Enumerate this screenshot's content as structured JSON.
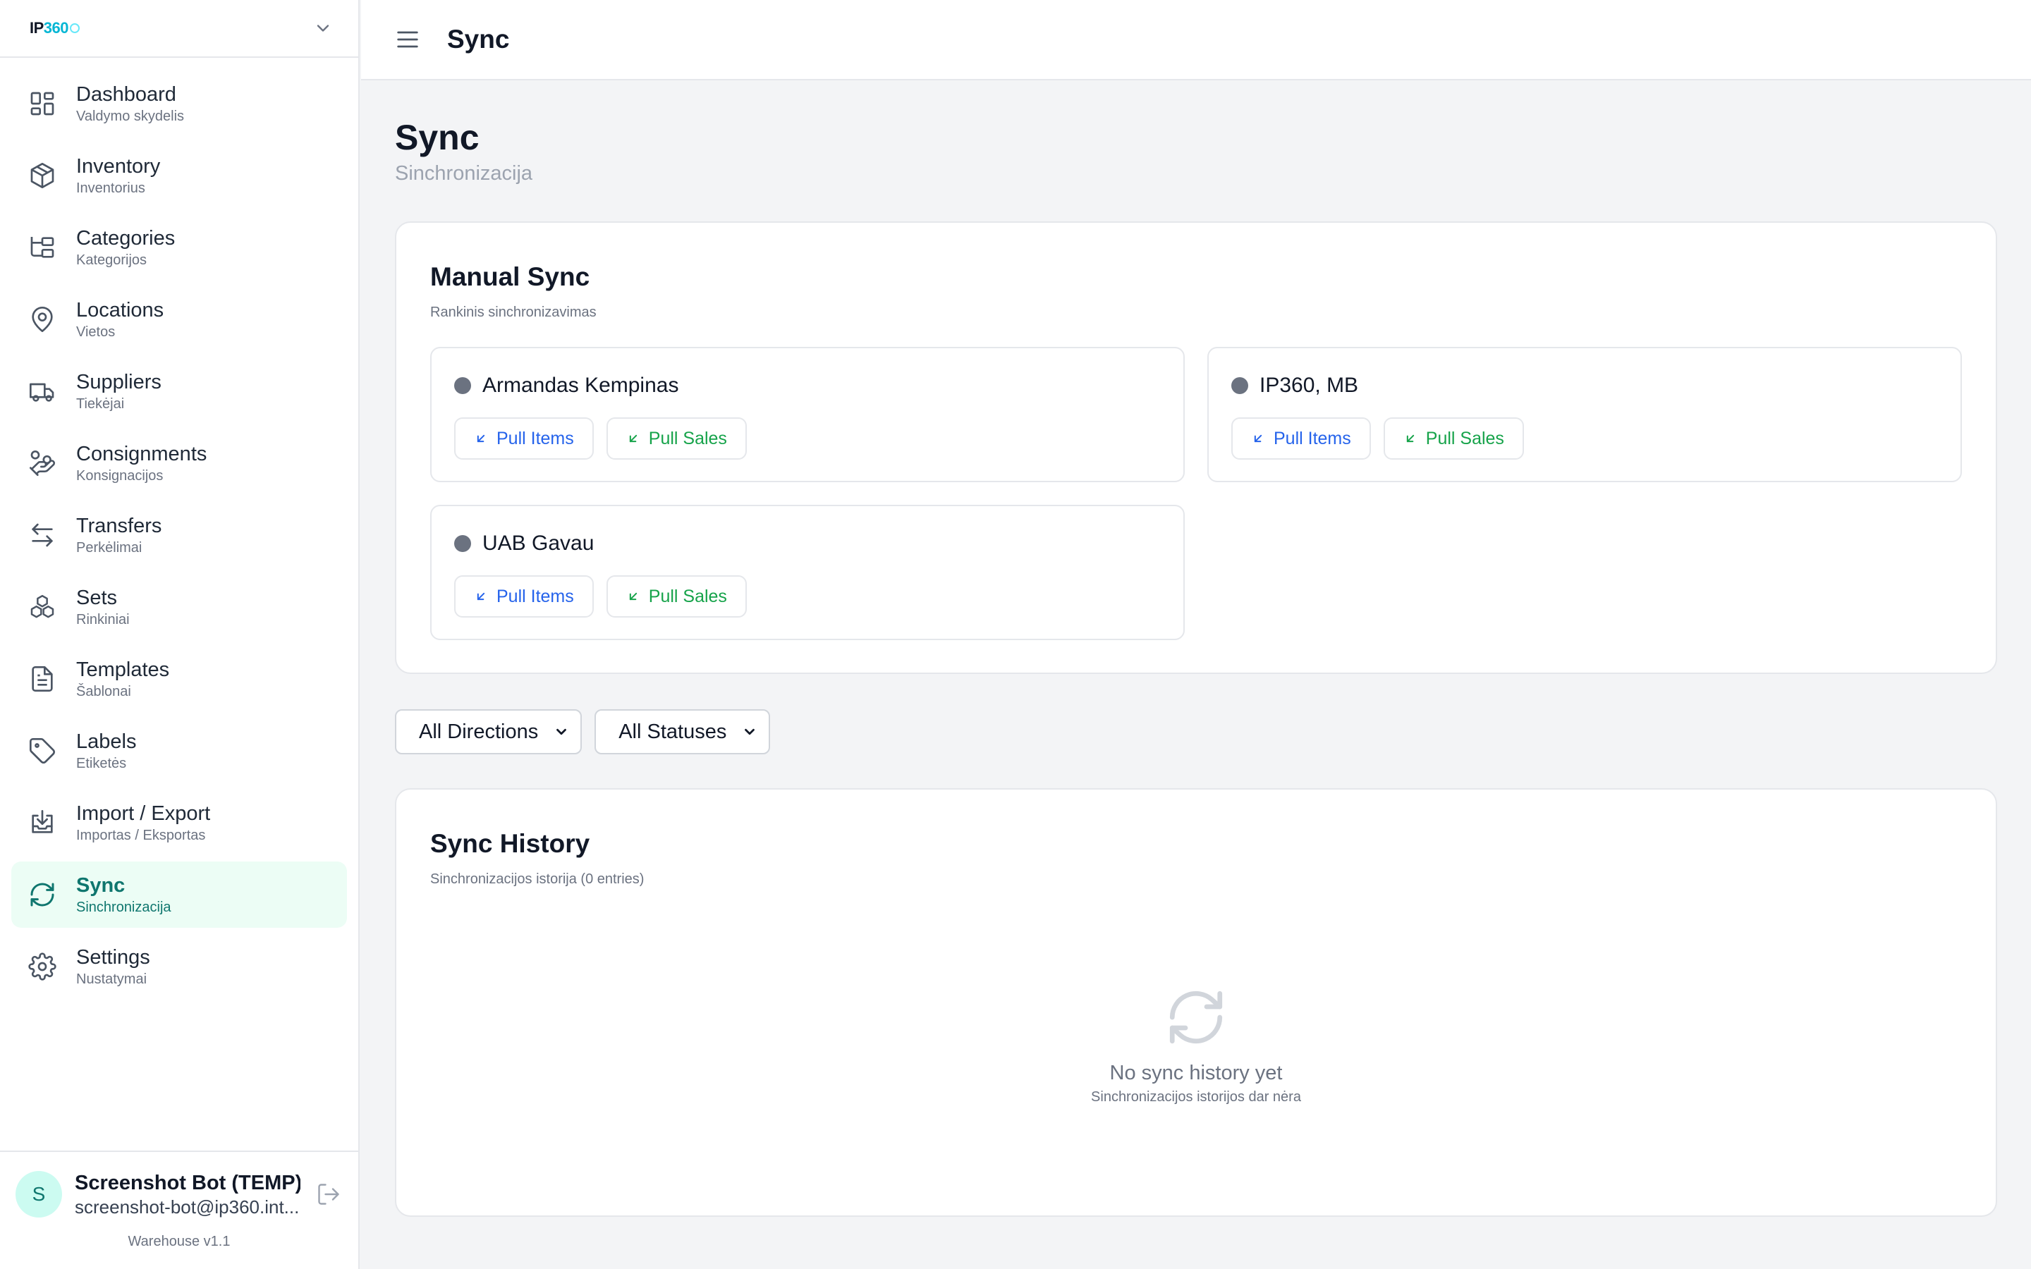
{
  "app": {
    "logo_main": "IP",
    "logo_accent": "360",
    "version": "Warehouse v1.1"
  },
  "sidebar": {
    "items": [
      {
        "label": "Dashboard",
        "sub": "Valdymo skydelis",
        "icon": "dashboard-grid-icon"
      },
      {
        "label": "Inventory",
        "sub": "Inventorius",
        "icon": "box-icon"
      },
      {
        "label": "Categories",
        "sub": "Kategorijos",
        "icon": "folder-tree-icon"
      },
      {
        "label": "Locations",
        "sub": "Vietos",
        "icon": "map-pin-icon"
      },
      {
        "label": "Suppliers",
        "sub": "Tiekėjai",
        "icon": "truck-icon"
      },
      {
        "label": "Consignments",
        "sub": "Konsignacijos",
        "icon": "hand-coins-icon"
      },
      {
        "label": "Transfers",
        "sub": "Perkėlimai",
        "icon": "arrows-left-right-icon"
      },
      {
        "label": "Sets",
        "sub": "Rinkiniai",
        "icon": "boxes-icon"
      },
      {
        "label": "Templates",
        "sub": "Šablonai",
        "icon": "file-text-icon"
      },
      {
        "label": "Labels",
        "sub": "Etiketės",
        "icon": "tag-icon"
      },
      {
        "label": "Import / Export",
        "sub": "Importas / Eksportas",
        "icon": "import-icon"
      },
      {
        "label": "Sync",
        "sub": "Sinchronizacija",
        "icon": "refresh-icon",
        "active": true
      },
      {
        "label": "Settings",
        "sub": "Nustatymai",
        "icon": "gear-icon"
      }
    ]
  },
  "user": {
    "initial": "S",
    "name": "Screenshot Bot (TEMP)",
    "email": "screenshot-bot@ip360.int..."
  },
  "topbar": {
    "title": "Sync"
  },
  "page": {
    "title": "Sync",
    "subtitle": "Sinchronizacija"
  },
  "manual_sync": {
    "title": "Manual Sync",
    "subtitle": "Rankinis sinchronizavimas",
    "pull_items_label": "Pull Items",
    "pull_sales_label": "Pull Sales",
    "accounts": [
      {
        "name": "Armandas Kempinas",
        "status_color": "#6b7280"
      },
      {
        "name": "IP360, MB",
        "status_color": "#6b7280"
      },
      {
        "name": "UAB Gavau",
        "status_color": "#6b7280"
      }
    ]
  },
  "filters": {
    "direction": "All Directions",
    "status": "All Statuses"
  },
  "sync_history": {
    "title": "Sync History",
    "subtitle": "Sinchronizacijos istorija (0 entries)",
    "empty_title": "No sync history yet",
    "empty_sub": "Sinchronizacijos istorijos dar nėra"
  },
  "colors": {
    "accent": "#0f766e",
    "active_bg": "#ecfdf5",
    "pull_items": "#2563eb",
    "pull_sales": "#16a34a"
  }
}
